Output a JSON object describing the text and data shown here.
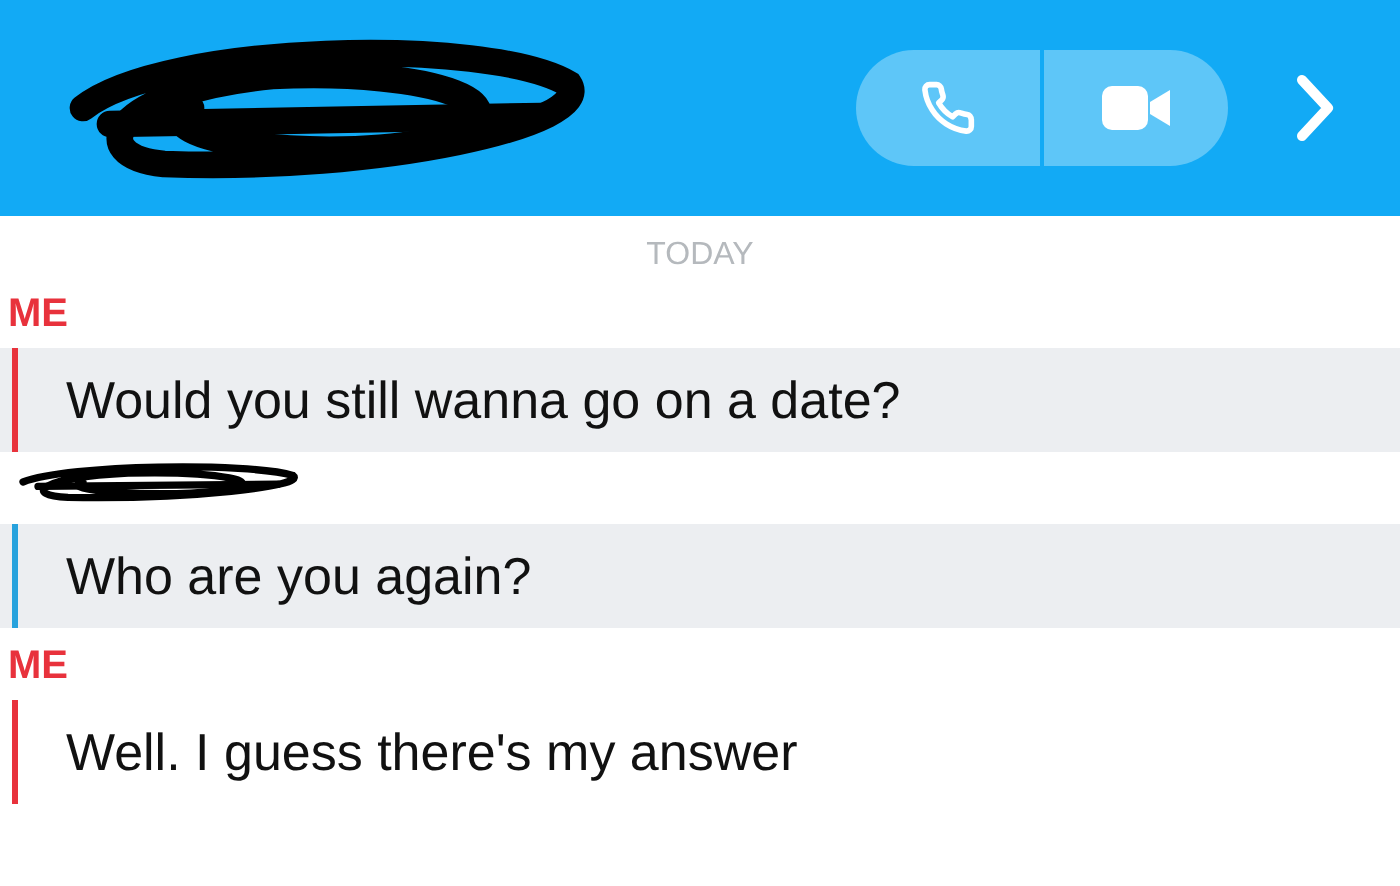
{
  "header": {
    "name_redacted": true
  },
  "date_label": "TODAY",
  "messages": [
    {
      "sender": "ME",
      "from_me": true,
      "saved": true,
      "text": "Would you still wanna go on a date?"
    },
    {
      "sender_redacted": true,
      "from_me": false,
      "saved": true,
      "text": "Who are you again?"
    },
    {
      "sender": "ME",
      "from_me": true,
      "saved": false,
      "text": "Well. I guess there's my answer"
    }
  ]
}
